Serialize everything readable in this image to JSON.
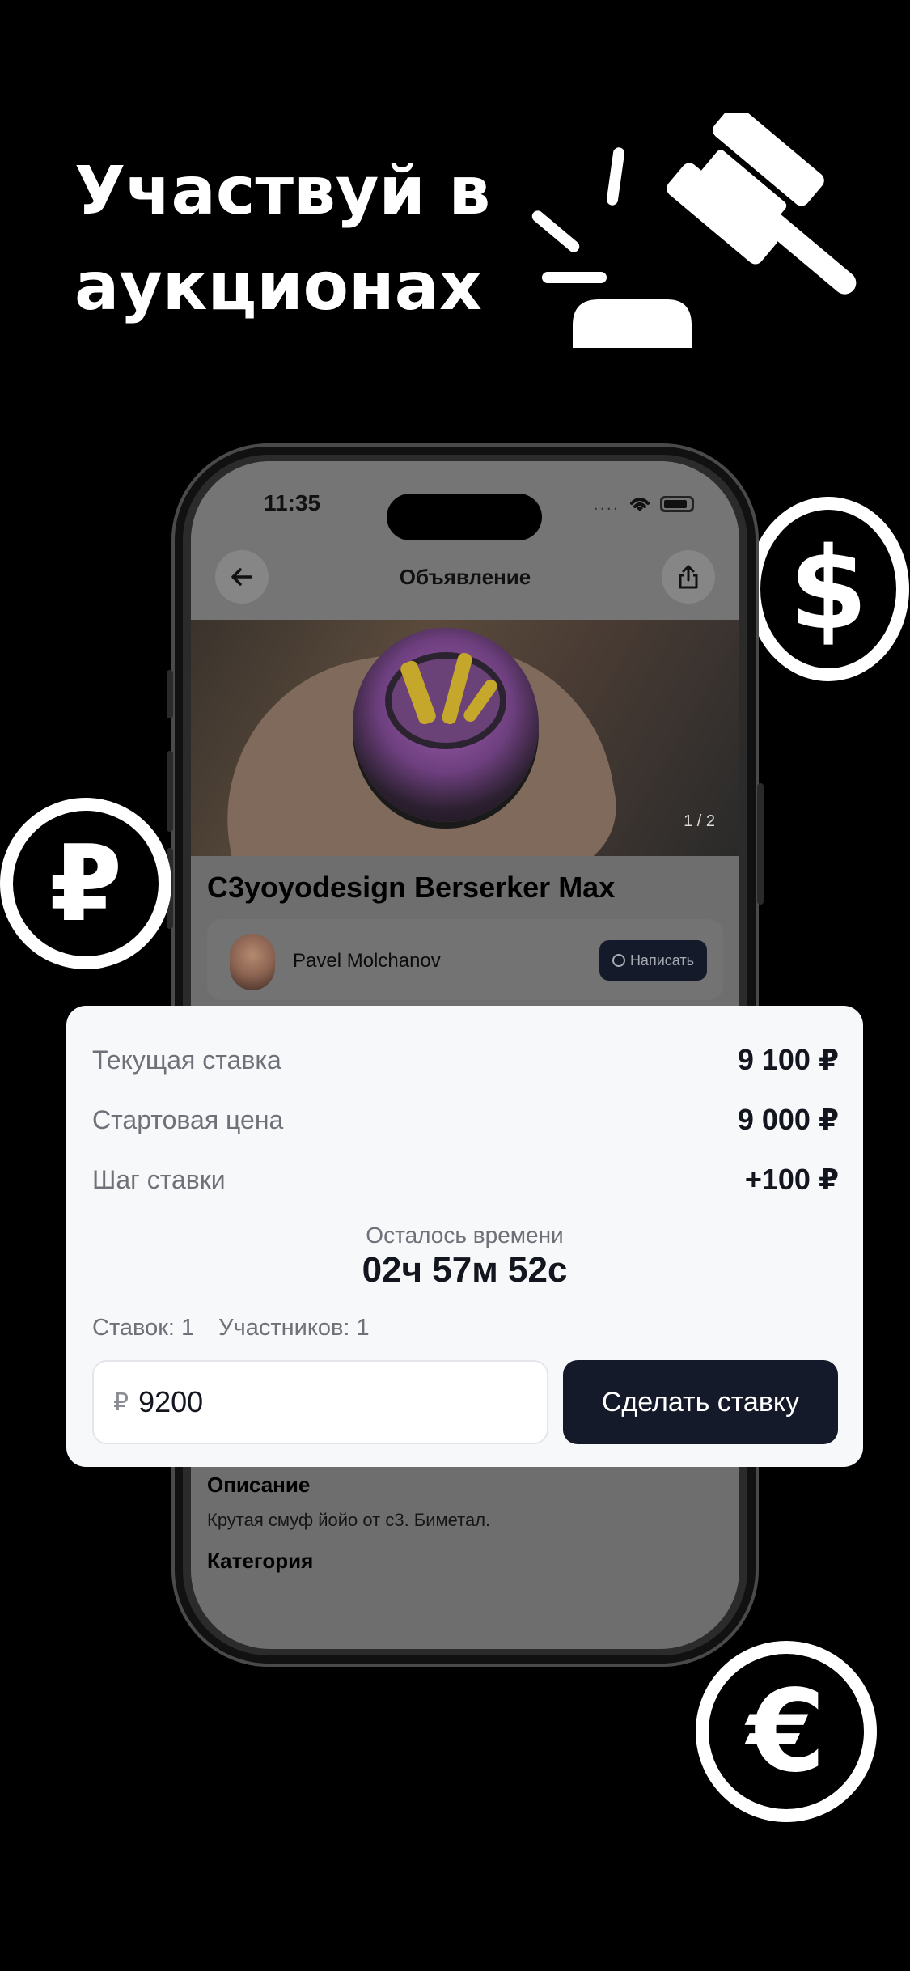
{
  "headline": {
    "line1": "Участвуй в",
    "line2": "аукционах"
  },
  "decor": {
    "dollar": "$",
    "ruble": "₽",
    "euro": "€"
  },
  "status_bar": {
    "time": "11:35",
    "dots": "...."
  },
  "nav": {
    "back_icon": "arrow-left",
    "title": "Объявление",
    "share_icon": "share"
  },
  "photo": {
    "counter": "1 / 2"
  },
  "product": {
    "title": "C3yoyodesign Berserker Max"
  },
  "seller": {
    "name": "Pavel Molchanov",
    "message_button": "Написать"
  },
  "bid_panel": {
    "current_bid_label": "Текущая ставка",
    "current_bid_value": "9 100 ₽",
    "start_price_label": "Стартовая цена",
    "start_price_value": "9 000 ₽",
    "bid_step_label": "Шаг ставки",
    "bid_step_value": "+100 ₽",
    "time_left_label": "Осталось времени",
    "time_left_value": "02ч 57м 52с",
    "bids_count": "Ставок: 1",
    "participants_count": "Участников: 1",
    "input_currency": "₽",
    "input_value": "9200",
    "submit_button": "Сделать ставку"
  },
  "description": {
    "title": "Описание",
    "text": "Крутая смуф йойо от c3. Биметал.",
    "category_title": "Категория"
  },
  "colors": {
    "background": "#000000",
    "panel": "#f7f8fa",
    "primary_button": "#141a2a"
  }
}
